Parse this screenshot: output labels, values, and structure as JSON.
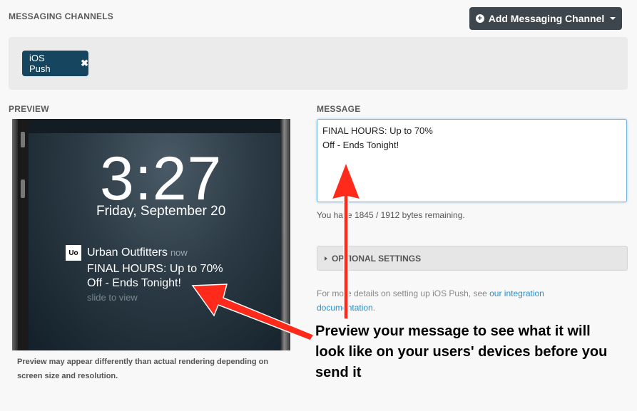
{
  "header": {
    "title": "MESSAGING CHANNELS",
    "add_button_label": "Add Messaging Channel"
  },
  "channels": [
    {
      "label": "iOS Push"
    }
  ],
  "preview": {
    "title": "PREVIEW",
    "time": "3:27",
    "date": "Friday, September 20",
    "notification": {
      "icon_text": "Uo",
      "app_name": "Urban Outfitters",
      "time": "now",
      "line1": "FINAL HOURS: Up to 70%",
      "line2": "Off - Ends Tonight!",
      "slide_text": "slide to view"
    },
    "note": "Preview may appear differently than actual rendering depending on screen size and resolution."
  },
  "message": {
    "title": "MESSAGE",
    "value": "FINAL HOURS: Up to 70%\nOff - Ends Tonight!",
    "bytes_text": "You have 1845 / 1912 bytes remaining.",
    "optional_settings_label": "OPTIONAL SETTINGS",
    "details_prefix": "For more details on setting up iOS Push, see ",
    "details_link": "our integration documentation",
    "details_suffix": "."
  },
  "callout": {
    "text": "Preview your message to see what it will look like on your users' devices before you send it"
  },
  "colors": {
    "channel_tag": "#16465f",
    "add_button": "#3d464d",
    "arrow": "#ff2a1a",
    "link": "#2a8fc9"
  }
}
